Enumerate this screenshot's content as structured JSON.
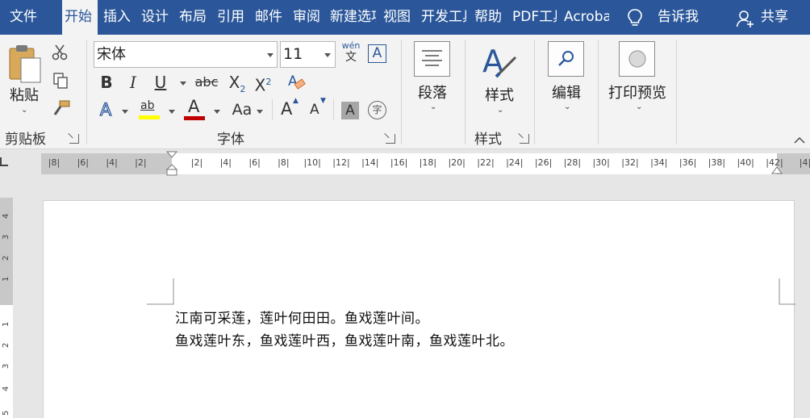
{
  "tabs": [
    {
      "label": "文件",
      "active": false
    },
    {
      "label": "开始",
      "active": true
    },
    {
      "label": "插入",
      "active": false
    },
    {
      "label": "设计",
      "active": false
    },
    {
      "label": "布局",
      "active": false
    },
    {
      "label": "引用",
      "active": false
    },
    {
      "label": "邮件",
      "active": false
    },
    {
      "label": "审阅",
      "active": false
    },
    {
      "label": "新建选项",
      "active": false
    },
    {
      "label": "视图",
      "active": false
    },
    {
      "label": "开发工具",
      "active": false
    },
    {
      "label": "帮助",
      "active": false
    },
    {
      "label": "PDF工具",
      "active": false
    },
    {
      "label": "Acrobat",
      "active": false
    }
  ],
  "tell_me": "告诉我",
  "share": "共享",
  "clipboard": {
    "paste_label": "粘贴",
    "group_label": "剪贴板"
  },
  "font": {
    "name": "宋体",
    "size": "11",
    "group_label": "字体",
    "phonetic_top": "wén",
    "phonetic_bottom": "文",
    "bold": "B",
    "italic": "I",
    "underline": "U",
    "strike": "abc",
    "subscript": "X",
    "subscript_mark": "2",
    "superscript": "X",
    "superscript_mark": "2",
    "text_effect": "A",
    "highlight": "ab",
    "font_color": "A",
    "change_case": "Aa",
    "grow": "A",
    "shrink": "A",
    "char_shading": "A",
    "enclose": "字",
    "border_char": "A",
    "highlight_color": "#ffff00",
    "font_color_value": "#c00000"
  },
  "paragraph": {
    "label": "段落"
  },
  "styles": {
    "label": "样式",
    "group_label": "样式"
  },
  "editing": {
    "label": "编辑"
  },
  "print_preview": {
    "label": "打印预览"
  },
  "ruler": {
    "labels": [
      "8",
      "6",
      "4",
      "2",
      "2",
      "4",
      "6",
      "8",
      "10",
      "12",
      "14",
      "16",
      "18",
      "20",
      "22",
      "24",
      "26",
      "28",
      "30",
      "32",
      "34",
      "36",
      "38",
      "40",
      "42",
      "4"
    ]
  },
  "vruler": {
    "labels": [
      "4",
      "3",
      "2",
      "1",
      "1",
      "2",
      "3",
      "4",
      "5"
    ]
  },
  "document": {
    "lines": [
      "江南可采莲，莲叶何田田。鱼戏莲叶间。",
      "鱼戏莲叶东，鱼戏莲叶西，鱼戏莲叶南，鱼戏莲叶北。"
    ]
  },
  "colors": {
    "accent": "#2b579a",
    "ribbon_bg": "#f3f3f3",
    "canvas_bg": "#e6e6e6"
  }
}
